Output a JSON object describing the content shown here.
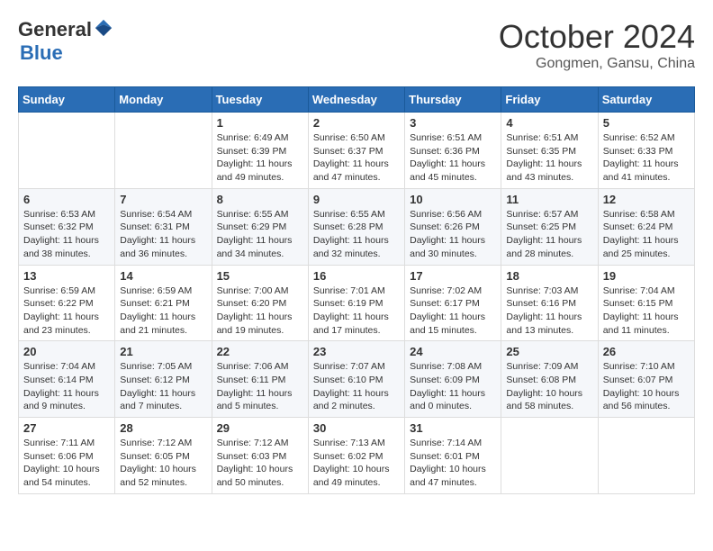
{
  "header": {
    "logo_general": "General",
    "logo_blue": "Blue",
    "month_title": "October 2024",
    "location": "Gongmen, Gansu, China"
  },
  "calendar": {
    "days_of_week": [
      "Sunday",
      "Monday",
      "Tuesday",
      "Wednesday",
      "Thursday",
      "Friday",
      "Saturday"
    ],
    "weeks": [
      [
        {
          "day": "",
          "info": ""
        },
        {
          "day": "",
          "info": ""
        },
        {
          "day": "1",
          "info": "Sunrise: 6:49 AM\nSunset: 6:39 PM\nDaylight: 11 hours and 49 minutes."
        },
        {
          "day": "2",
          "info": "Sunrise: 6:50 AM\nSunset: 6:37 PM\nDaylight: 11 hours and 47 minutes."
        },
        {
          "day": "3",
          "info": "Sunrise: 6:51 AM\nSunset: 6:36 PM\nDaylight: 11 hours and 45 minutes."
        },
        {
          "day": "4",
          "info": "Sunrise: 6:51 AM\nSunset: 6:35 PM\nDaylight: 11 hours and 43 minutes."
        },
        {
          "day": "5",
          "info": "Sunrise: 6:52 AM\nSunset: 6:33 PM\nDaylight: 11 hours and 41 minutes."
        }
      ],
      [
        {
          "day": "6",
          "info": "Sunrise: 6:53 AM\nSunset: 6:32 PM\nDaylight: 11 hours and 38 minutes."
        },
        {
          "day": "7",
          "info": "Sunrise: 6:54 AM\nSunset: 6:31 PM\nDaylight: 11 hours and 36 minutes."
        },
        {
          "day": "8",
          "info": "Sunrise: 6:55 AM\nSunset: 6:29 PM\nDaylight: 11 hours and 34 minutes."
        },
        {
          "day": "9",
          "info": "Sunrise: 6:55 AM\nSunset: 6:28 PM\nDaylight: 11 hours and 32 minutes."
        },
        {
          "day": "10",
          "info": "Sunrise: 6:56 AM\nSunset: 6:26 PM\nDaylight: 11 hours and 30 minutes."
        },
        {
          "day": "11",
          "info": "Sunrise: 6:57 AM\nSunset: 6:25 PM\nDaylight: 11 hours and 28 minutes."
        },
        {
          "day": "12",
          "info": "Sunrise: 6:58 AM\nSunset: 6:24 PM\nDaylight: 11 hours and 25 minutes."
        }
      ],
      [
        {
          "day": "13",
          "info": "Sunrise: 6:59 AM\nSunset: 6:22 PM\nDaylight: 11 hours and 23 minutes."
        },
        {
          "day": "14",
          "info": "Sunrise: 6:59 AM\nSunset: 6:21 PM\nDaylight: 11 hours and 21 minutes."
        },
        {
          "day": "15",
          "info": "Sunrise: 7:00 AM\nSunset: 6:20 PM\nDaylight: 11 hours and 19 minutes."
        },
        {
          "day": "16",
          "info": "Sunrise: 7:01 AM\nSunset: 6:19 PM\nDaylight: 11 hours and 17 minutes."
        },
        {
          "day": "17",
          "info": "Sunrise: 7:02 AM\nSunset: 6:17 PM\nDaylight: 11 hours and 15 minutes."
        },
        {
          "day": "18",
          "info": "Sunrise: 7:03 AM\nSunset: 6:16 PM\nDaylight: 11 hours and 13 minutes."
        },
        {
          "day": "19",
          "info": "Sunrise: 7:04 AM\nSunset: 6:15 PM\nDaylight: 11 hours and 11 minutes."
        }
      ],
      [
        {
          "day": "20",
          "info": "Sunrise: 7:04 AM\nSunset: 6:14 PM\nDaylight: 11 hours and 9 minutes."
        },
        {
          "day": "21",
          "info": "Sunrise: 7:05 AM\nSunset: 6:12 PM\nDaylight: 11 hours and 7 minutes."
        },
        {
          "day": "22",
          "info": "Sunrise: 7:06 AM\nSunset: 6:11 PM\nDaylight: 11 hours and 5 minutes."
        },
        {
          "day": "23",
          "info": "Sunrise: 7:07 AM\nSunset: 6:10 PM\nDaylight: 11 hours and 2 minutes."
        },
        {
          "day": "24",
          "info": "Sunrise: 7:08 AM\nSunset: 6:09 PM\nDaylight: 11 hours and 0 minutes."
        },
        {
          "day": "25",
          "info": "Sunrise: 7:09 AM\nSunset: 6:08 PM\nDaylight: 10 hours and 58 minutes."
        },
        {
          "day": "26",
          "info": "Sunrise: 7:10 AM\nSunset: 6:07 PM\nDaylight: 10 hours and 56 minutes."
        }
      ],
      [
        {
          "day": "27",
          "info": "Sunrise: 7:11 AM\nSunset: 6:06 PM\nDaylight: 10 hours and 54 minutes."
        },
        {
          "day": "28",
          "info": "Sunrise: 7:12 AM\nSunset: 6:05 PM\nDaylight: 10 hours and 52 minutes."
        },
        {
          "day": "29",
          "info": "Sunrise: 7:12 AM\nSunset: 6:03 PM\nDaylight: 10 hours and 50 minutes."
        },
        {
          "day": "30",
          "info": "Sunrise: 7:13 AM\nSunset: 6:02 PM\nDaylight: 10 hours and 49 minutes."
        },
        {
          "day": "31",
          "info": "Sunrise: 7:14 AM\nSunset: 6:01 PM\nDaylight: 10 hours and 47 minutes."
        },
        {
          "day": "",
          "info": ""
        },
        {
          "day": "",
          "info": ""
        }
      ]
    ]
  }
}
